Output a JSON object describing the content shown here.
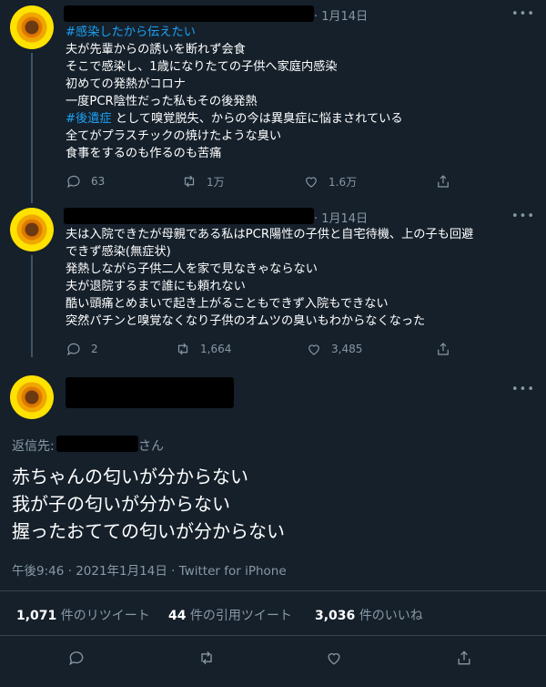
{
  "tweet1": {
    "date": "· 1月14日",
    "more": "•••",
    "lines": [
      {
        "link": "#感染したから伝えたい",
        "text": ""
      },
      {
        "link": "",
        "text": "夫が先輩からの誘いを断れず会食"
      },
      {
        "link": "",
        "text": "そこで感染し、1歳になりたての子供へ家庭内感染"
      },
      {
        "link": "",
        "text": "初めての発熱がコロナ"
      },
      {
        "link": "",
        "text": "一度PCR陰性だった私もその後発熱"
      },
      {
        "link": "#後遺症",
        "text": " として嗅覚脱失、からの今は異臭症に悩まされている"
      },
      {
        "link": "",
        "text": "全てがプラスチックの焼けたような臭い"
      },
      {
        "link": "",
        "text": "食事をするのも作るのも苦痛"
      }
    ],
    "reply_count": "63",
    "retweet_count": "1万",
    "like_count": "1.6万"
  },
  "tweet2": {
    "date": "· 1月14日",
    "more": "•••",
    "lines": [
      "夫は入院できたが母親である私はPCR陽性の子供と自宅待機、上の子も回避",
      "できず感染(無症状)",
      "発熱しながら子供二人を家で見なきゃならない",
      "夫が退院するまで誰にも頼れない",
      "酷い頭痛とめまいで起き上がることもできず入院もできない",
      "突然パチンと嗅覚なくなり子供のオムツの臭いもわからなくなった"
    ],
    "reply_count": "2",
    "retweet_count": "1,664",
    "like_count": "3,485"
  },
  "main": {
    "more": "•••",
    "reply_to_label": "返信先:",
    "reply_to_suffix": "さん",
    "lines": [
      "赤ちゃんの匂いが分からない",
      "我が子の匂いが分からない",
      "握ったおてての匂いが分からない"
    ],
    "timestamp": "午後9:46 · 2021年1月14日 · Twitter for iPhone",
    "retweets_num": "1,071",
    "retweets_label": " 件のリツイート",
    "quotes_num": "44",
    "quotes_label": " 件の引用ツイート",
    "likes_num": "3,036",
    "likes_label": " 件のいいね"
  },
  "colors": {
    "background": "#15202b",
    "link": "#1da1f2",
    "secondary": "#8899a6"
  }
}
